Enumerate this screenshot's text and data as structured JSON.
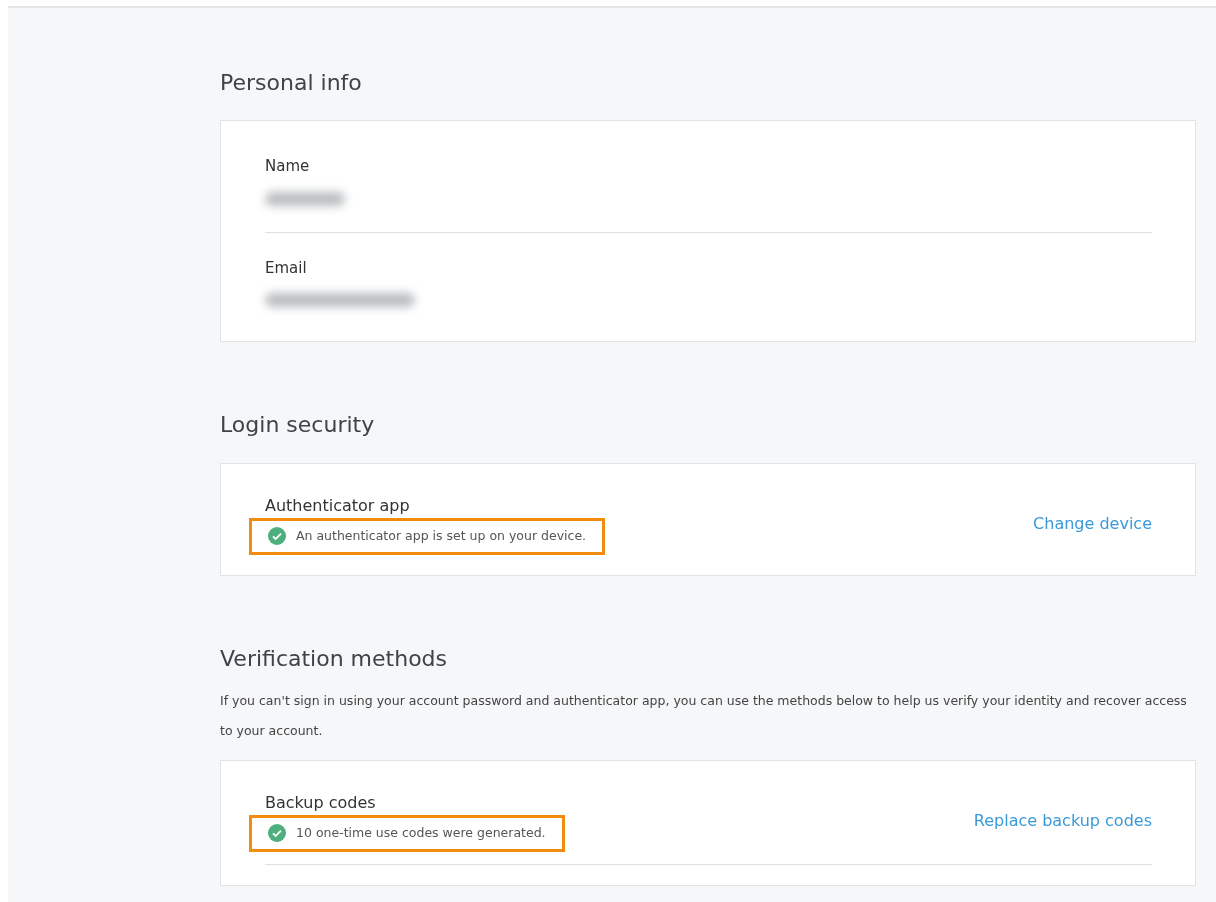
{
  "sections": [
    {
      "title": "Personal info",
      "kind": "fields",
      "fields": [
        {
          "label": "Name",
          "redacted": true
        },
        {
          "label": "Email",
          "redacted": true
        }
      ]
    },
    {
      "title": "Login security",
      "kind": "methods",
      "methods": [
        {
          "title": "Authenticator app",
          "status": "An authenticator app is set up on your device.",
          "verified": true,
          "highlighted": true,
          "action": "Change device",
          "divider": false
        }
      ]
    },
    {
      "title": "Verification methods",
      "kind": "methods",
      "description": "If you can't sign in using your account password and authenticator app, you can use the methods below to help us verify your identity and recover access to your account.",
      "methods": [
        {
          "title": "Backup codes",
          "status": "10 one-time use codes were generated.",
          "verified": true,
          "highlighted": true,
          "action": "Replace backup codes",
          "divider": true
        }
      ]
    }
  ]
}
